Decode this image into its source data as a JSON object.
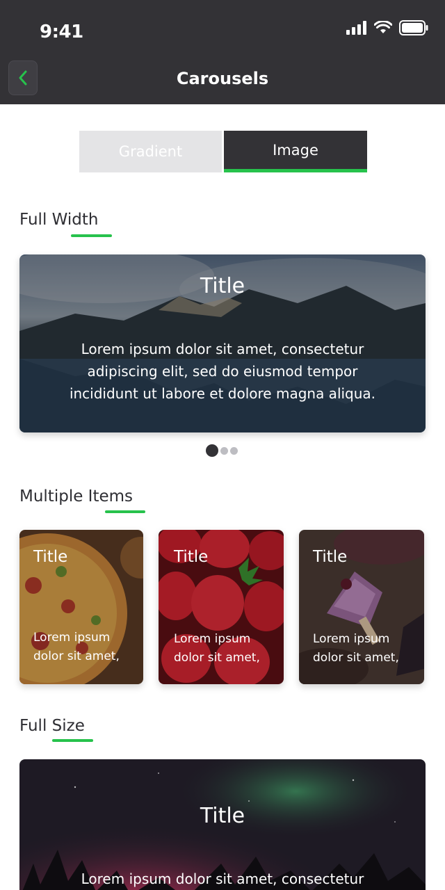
{
  "status_bar": {
    "time": "9:41"
  },
  "nav": {
    "title": "Carousels"
  },
  "segments": {
    "gradient": "Gradient",
    "image": "Image",
    "selected": "Image"
  },
  "sections": {
    "full_width": {
      "title": "Full Width",
      "card": {
        "title": "Title",
        "text_lines": [
          "Lorem ipsum dolor sit amet, consectetur",
          "adipiscing elit, sed do eiusmod tempor",
          "incididunt ut labore et dolore magna aliqua."
        ]
      },
      "pagination": {
        "count": 3,
        "active_index": 0
      }
    },
    "multiple_items": {
      "title": "Multiple Items",
      "cards": [
        {
          "title": "Title",
          "text_lines": [
            "Lorem ipsum",
            "dolor sit amet,"
          ]
        },
        {
          "title": "Title",
          "text_lines": [
            "Lorem ipsum",
            "dolor sit amet,"
          ]
        },
        {
          "title": "Title",
          "text_lines": [
            "Lorem ipsum",
            "dolor sit amet,"
          ]
        }
      ]
    },
    "full_size": {
      "title": "Full Size",
      "card": {
        "title": "Title",
        "text_lines": [
          "Lorem ipsum dolor sit amet, consectetur"
        ]
      }
    }
  },
  "colors": {
    "accent": "#27c24c",
    "header_bg": "#333236",
    "segment_inactive": "#e4e4e6"
  }
}
